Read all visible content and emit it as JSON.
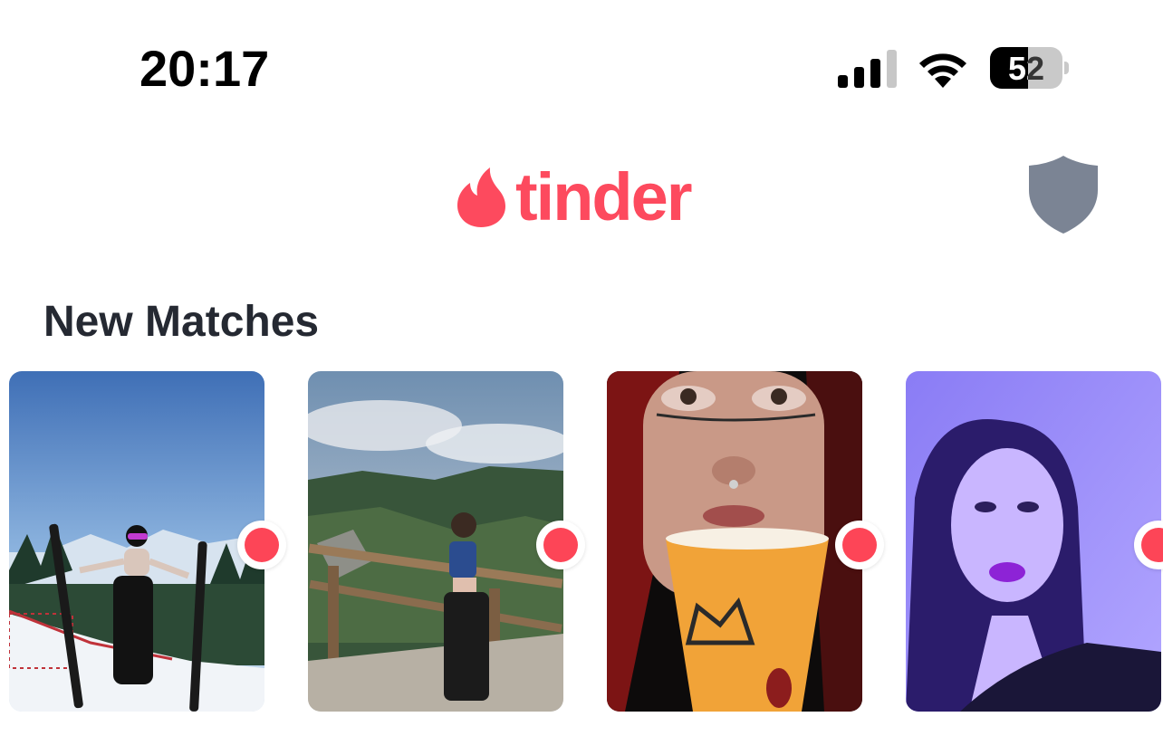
{
  "status_bar": {
    "time": "20:17",
    "battery_level": "52",
    "battery_fraction": 0.52,
    "signal_bars": 3,
    "icons": [
      "cellular-signal-icon",
      "wifi-icon",
      "battery-icon"
    ]
  },
  "header": {
    "brand_name": "tinder",
    "logo_icon": "flame-icon",
    "right_icon": "shield-icon",
    "brand_color": "#fd4a5e",
    "shield_color": "#7b8494"
  },
  "new_matches": {
    "title": "New Matches",
    "indicator_color": "#fd4557",
    "matches": [
      {
        "photo": "woman-with-skis-on-snowy-mountain",
        "new": true
      },
      {
        "photo": "woman-on-wooden-lookout-over-forest",
        "new": true
      },
      {
        "photo": "woman-with-red-hair-drinking-orange-cup",
        "new": true
      },
      {
        "photo": "woman-portrait-in-purple-light",
        "new": true
      }
    ]
  }
}
